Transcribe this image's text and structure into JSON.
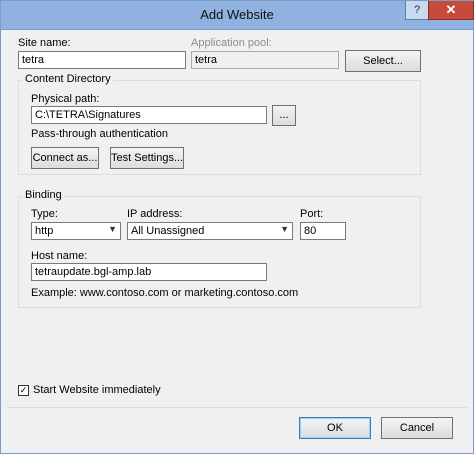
{
  "window": {
    "title": "Add Website",
    "help_glyph": "?",
    "close_glyph": "✕"
  },
  "site": {
    "site_name_label": "Site name:",
    "site_name_value": "tetra",
    "app_pool_label": "Application pool:",
    "app_pool_value": "tetra",
    "select_button": "Select..."
  },
  "content_directory": {
    "group_title": "Content Directory",
    "physical_path_label": "Physical path:",
    "physical_path_value": "C:\\TETRA\\Signatures",
    "browse_button": "...",
    "pass_through_label": "Pass-through authentication",
    "connect_as_button": "Connect as...",
    "test_settings_button": "Test Settings..."
  },
  "binding": {
    "group_title": "Binding",
    "type_label": "Type:",
    "type_value": "http",
    "ip_label": "IP address:",
    "ip_value": "All Unassigned",
    "port_label": "Port:",
    "port_value": "80",
    "host_name_label": "Host name:",
    "host_name_value": "tetraupdate.bgl-amp.lab",
    "example_text": "Example: www.contoso.com or marketing.contoso.com"
  },
  "start": {
    "checked": true,
    "check_glyph": "✓",
    "label": "Start Website immediately"
  },
  "footer": {
    "ok_button": "OK",
    "cancel_button": "Cancel"
  },
  "icons": {
    "dropdown_arrow": "▼"
  }
}
